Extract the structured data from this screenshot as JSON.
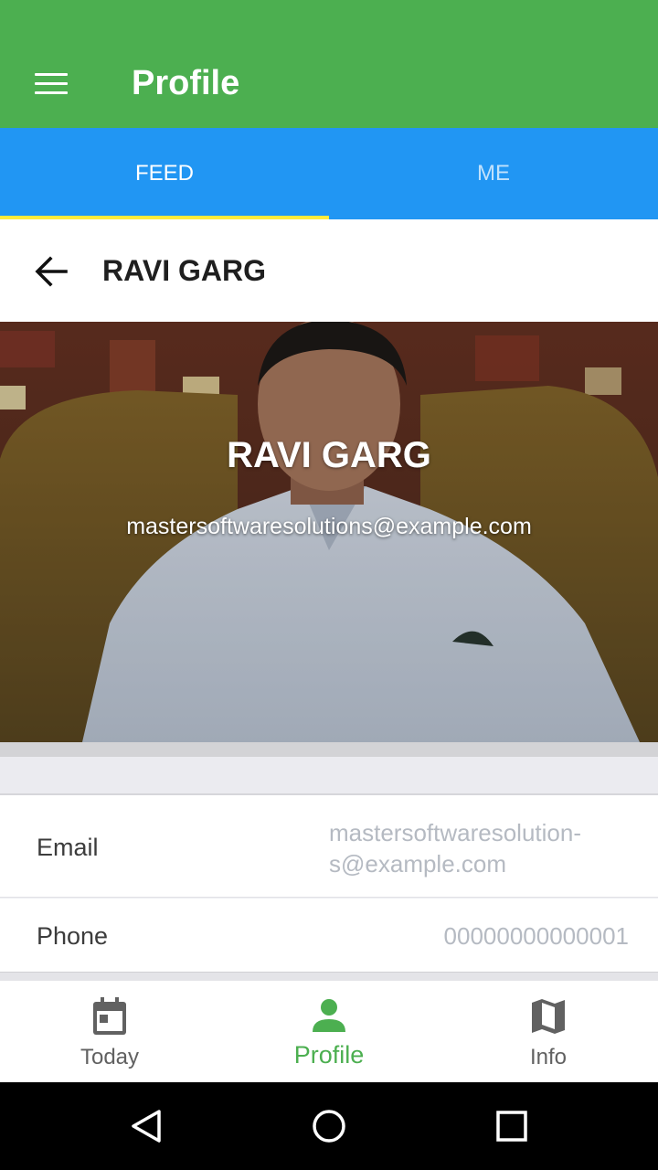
{
  "appbar": {
    "title": "Profile",
    "menu_icon": "hamburger-menu-icon"
  },
  "tabs": [
    {
      "label": "FEED",
      "active": true
    },
    {
      "label": "ME",
      "active": false
    }
  ],
  "subheader": {
    "back_icon": "arrow-back-icon",
    "title": "RAVI GARG"
  },
  "hero": {
    "name": "RAVI GARG",
    "email": "mastersoftwaresolutions@example.com"
  },
  "details": {
    "email_label": "Email",
    "email_value": "mastersoftwaresolution-s@example.com",
    "phone_label": "Phone",
    "phone_value": "00000000000001"
  },
  "bottom_nav": [
    {
      "label": "Today",
      "icon": "calendar-icon",
      "active": false
    },
    {
      "label": "Profile",
      "icon": "person-icon",
      "active": true
    },
    {
      "label": "Info",
      "icon": "map-icon",
      "active": false
    }
  ],
  "colors": {
    "appbar": "#4caf50",
    "tabs": "#2196f3",
    "tab_indicator": "#ffeb3b",
    "active_nav": "#4caf50",
    "muted_value": "#b5bac2"
  },
  "system_nav": {
    "back": "nav-back-icon",
    "home": "nav-home-icon",
    "recents": "nav-recents-icon"
  }
}
